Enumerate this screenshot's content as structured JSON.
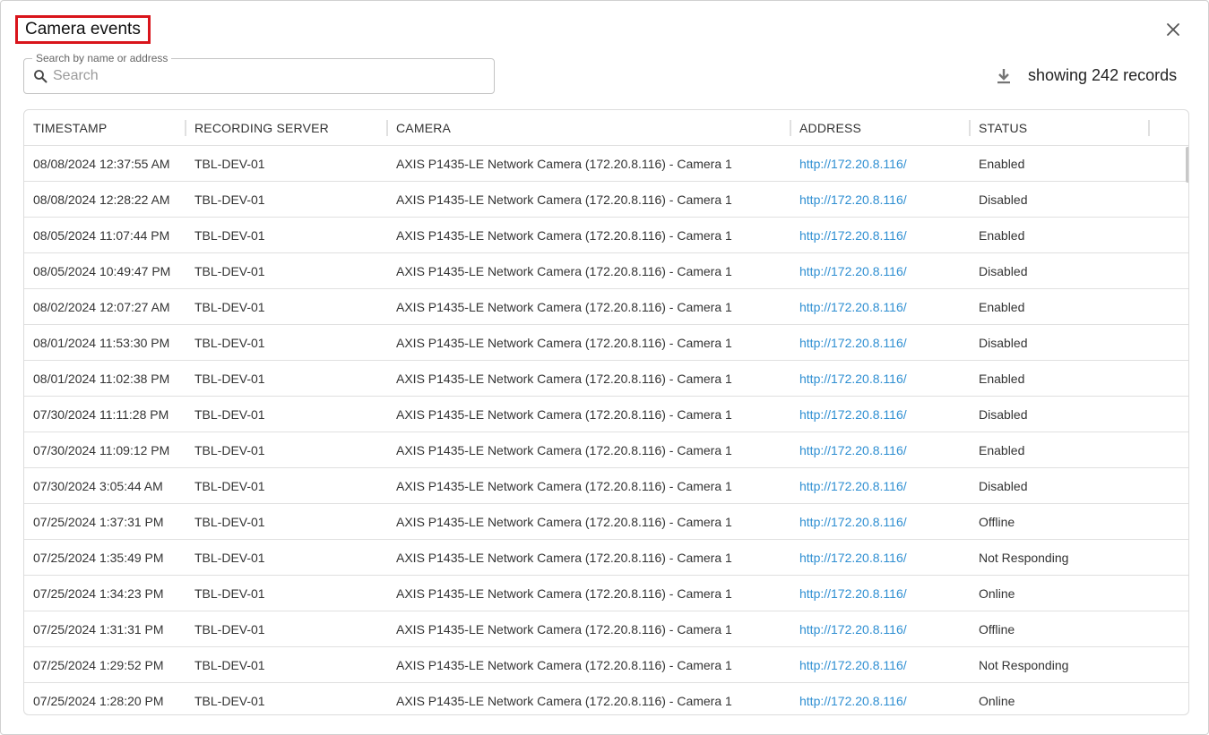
{
  "dialog": {
    "title": "Camera events",
    "close_icon": "close-icon"
  },
  "search": {
    "legend": "Search by name or address",
    "placeholder": "Search",
    "value": "",
    "icon": "search-icon"
  },
  "toolbar": {
    "download_icon": "download-icon",
    "records_text": "showing 242 records"
  },
  "table": {
    "columns": [
      "TIMESTAMP",
      "RECORDING SERVER",
      "CAMERA",
      "ADDRESS",
      "STATUS"
    ],
    "rows": [
      {
        "timestamp": "08/08/2024 12:37:55 AM",
        "server": "TBL-DEV-01",
        "camera": "AXIS P1435-LE Network Camera (172.20.8.116) - Camera 1",
        "address": "http://172.20.8.116/",
        "status": "Enabled"
      },
      {
        "timestamp": "08/08/2024 12:28:22 AM",
        "server": "TBL-DEV-01",
        "camera": "AXIS P1435-LE Network Camera (172.20.8.116) - Camera 1",
        "address": "http://172.20.8.116/",
        "status": "Disabled"
      },
      {
        "timestamp": "08/05/2024 11:07:44 PM",
        "server": "TBL-DEV-01",
        "camera": "AXIS P1435-LE Network Camera (172.20.8.116) - Camera 1",
        "address": "http://172.20.8.116/",
        "status": "Enabled"
      },
      {
        "timestamp": "08/05/2024 10:49:47 PM",
        "server": "TBL-DEV-01",
        "camera": "AXIS P1435-LE Network Camera (172.20.8.116) - Camera 1",
        "address": "http://172.20.8.116/",
        "status": "Disabled"
      },
      {
        "timestamp": "08/02/2024 12:07:27 AM",
        "server": "TBL-DEV-01",
        "camera": "AXIS P1435-LE Network Camera (172.20.8.116) - Camera 1",
        "address": "http://172.20.8.116/",
        "status": "Enabled"
      },
      {
        "timestamp": "08/01/2024 11:53:30 PM",
        "server": "TBL-DEV-01",
        "camera": "AXIS P1435-LE Network Camera (172.20.8.116) - Camera 1",
        "address": "http://172.20.8.116/",
        "status": "Disabled"
      },
      {
        "timestamp": "08/01/2024 11:02:38 PM",
        "server": "TBL-DEV-01",
        "camera": "AXIS P1435-LE Network Camera (172.20.8.116) - Camera 1",
        "address": "http://172.20.8.116/",
        "status": "Enabled"
      },
      {
        "timestamp": "07/30/2024 11:11:28 PM",
        "server": "TBL-DEV-01",
        "camera": "AXIS P1435-LE Network Camera (172.20.8.116) - Camera 1",
        "address": "http://172.20.8.116/",
        "status": "Disabled"
      },
      {
        "timestamp": "07/30/2024 11:09:12 PM",
        "server": "TBL-DEV-01",
        "camera": "AXIS P1435-LE Network Camera (172.20.8.116) - Camera 1",
        "address": "http://172.20.8.116/",
        "status": "Enabled"
      },
      {
        "timestamp": "07/30/2024 3:05:44 AM",
        "server": "TBL-DEV-01",
        "camera": "AXIS P1435-LE Network Camera (172.20.8.116) - Camera 1",
        "address": "http://172.20.8.116/",
        "status": "Disabled"
      },
      {
        "timestamp": "07/25/2024 1:37:31 PM",
        "server": "TBL-DEV-01",
        "camera": "AXIS P1435-LE Network Camera (172.20.8.116) - Camera 1",
        "address": "http://172.20.8.116/",
        "status": "Offline"
      },
      {
        "timestamp": "07/25/2024 1:35:49 PM",
        "server": "TBL-DEV-01",
        "camera": "AXIS P1435-LE Network Camera (172.20.8.116) - Camera 1",
        "address": "http://172.20.8.116/",
        "status": "Not Responding"
      },
      {
        "timestamp": "07/25/2024 1:34:23 PM",
        "server": "TBL-DEV-01",
        "camera": "AXIS P1435-LE Network Camera (172.20.8.116) - Camera 1",
        "address": "http://172.20.8.116/",
        "status": "Online"
      },
      {
        "timestamp": "07/25/2024 1:31:31 PM",
        "server": "TBL-DEV-01",
        "camera": "AXIS P1435-LE Network Camera (172.20.8.116) - Camera 1",
        "address": "http://172.20.8.116/",
        "status": "Offline"
      },
      {
        "timestamp": "07/25/2024 1:29:52 PM",
        "server": "TBL-DEV-01",
        "camera": "AXIS P1435-LE Network Camera (172.20.8.116) - Camera 1",
        "address": "http://172.20.8.116/",
        "status": "Not Responding"
      },
      {
        "timestamp": "07/25/2024 1:28:20 PM",
        "server": "TBL-DEV-01",
        "camera": "AXIS P1435-LE Network Camera (172.20.8.116) - Camera 1",
        "address": "http://172.20.8.116/",
        "status": "Online"
      }
    ]
  },
  "colors": {
    "title_highlight": "#d9141b",
    "link": "#2f8fd2"
  }
}
